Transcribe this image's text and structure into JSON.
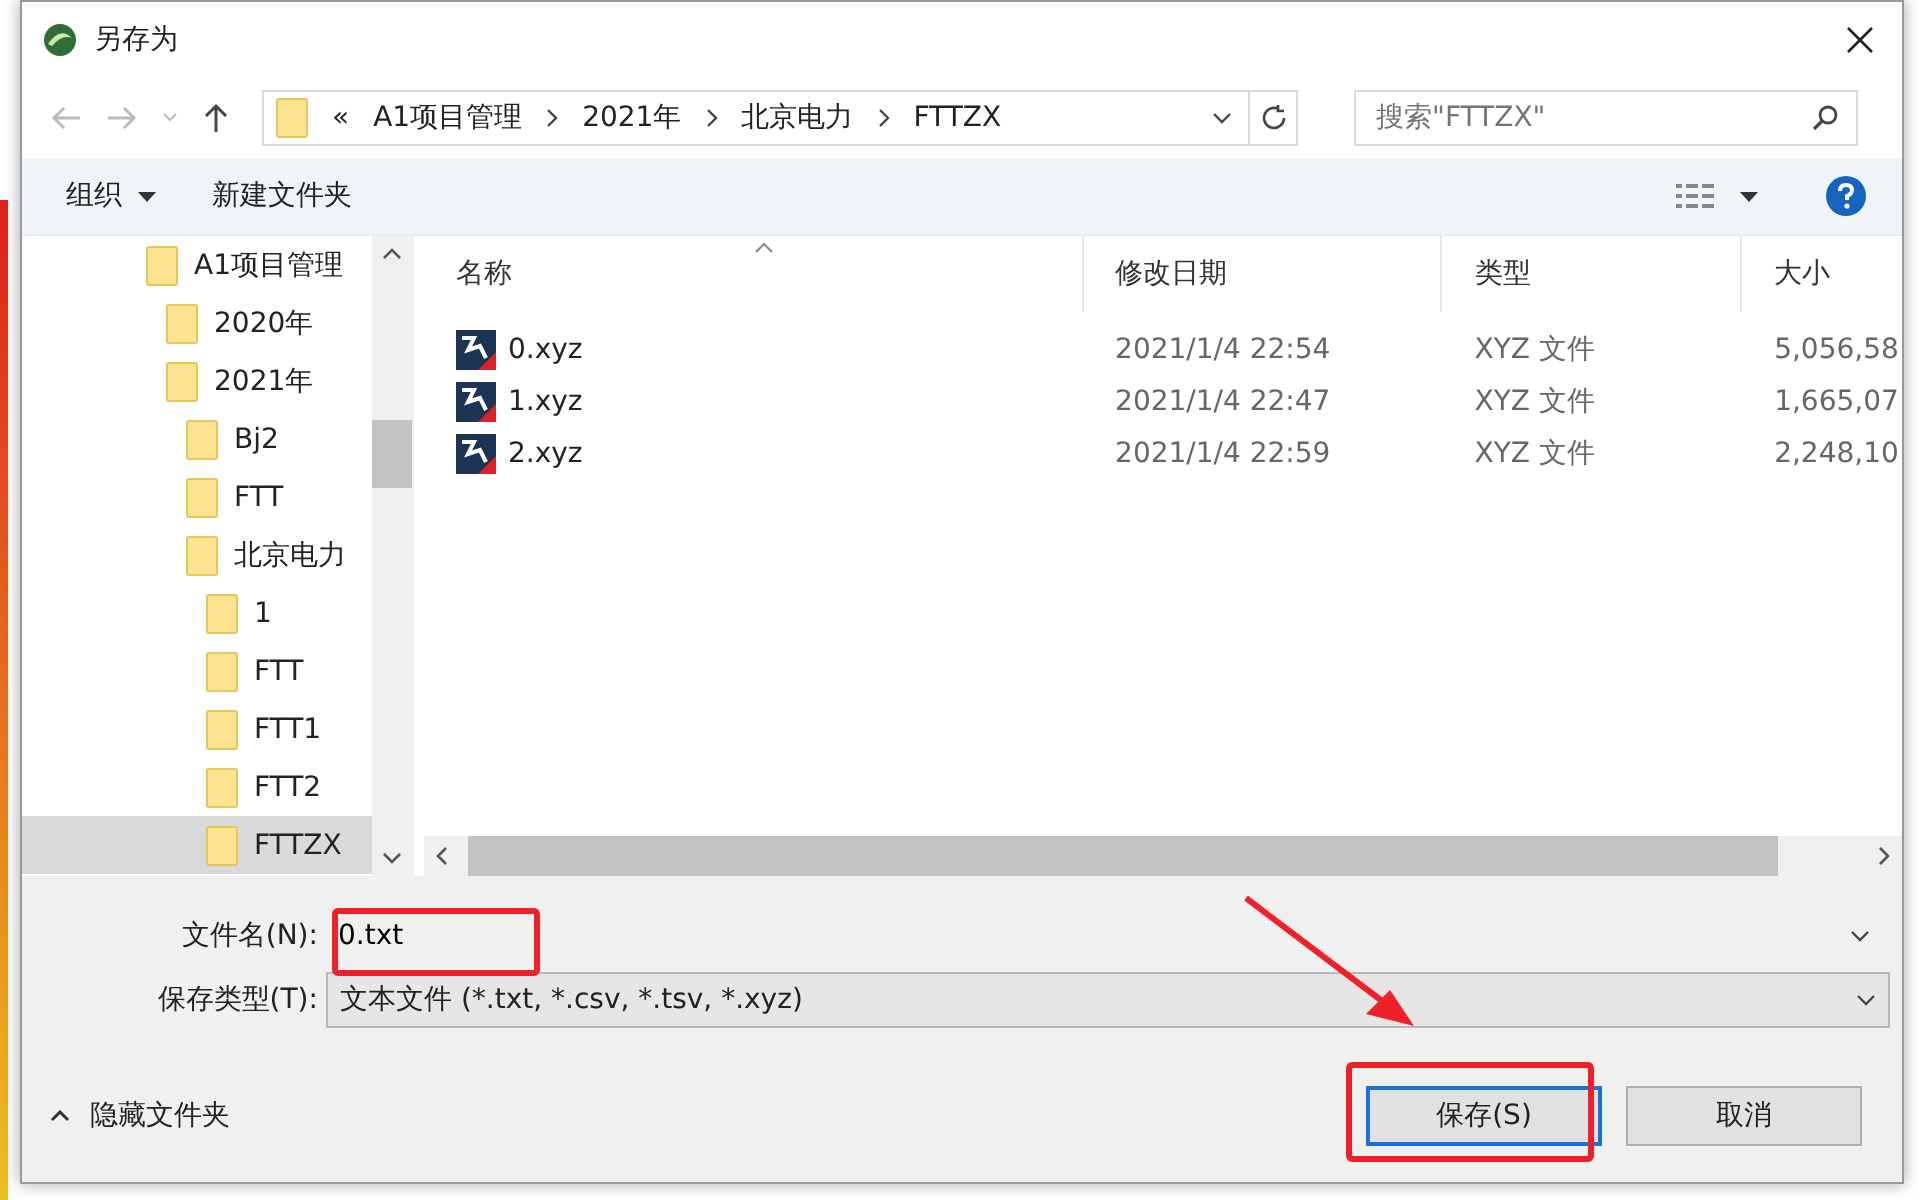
{
  "window": {
    "title": "另存为"
  },
  "address_bar": {
    "overflow": "«",
    "path": [
      "A1项目管理",
      "2021年",
      "北京电力",
      "FTTZX"
    ]
  },
  "search": {
    "placeholder": "搜索\"FTTZX\""
  },
  "toolbar": {
    "organize": "组织",
    "new_folder": "新建文件夹"
  },
  "tree": [
    {
      "label": "A1项目管理",
      "selected": false,
      "children": [
        {
          "label": "2020年",
          "selected": false
        },
        {
          "label": "2021年",
          "selected": false,
          "children": [
            {
              "label": "Bj2",
              "selected": false
            },
            {
              "label": "FTT",
              "selected": false
            },
            {
              "label": "北京电力",
              "selected": false,
              "children": [
                {
                  "label": "1",
                  "selected": false
                },
                {
                  "label": "FTT",
                  "selected": false
                },
                {
                  "label": "FTT1",
                  "selected": false
                },
                {
                  "label": "FTT2",
                  "selected": false
                },
                {
                  "label": "FTTZX",
                  "selected": true
                }
              ]
            }
          ]
        }
      ]
    }
  ],
  "columns": [
    "名称",
    "修改日期",
    "类型",
    "大小"
  ],
  "files": [
    {
      "name": "0.xyz",
      "modified": "2021/1/4 22:54",
      "type": "XYZ 文件",
      "size": "5,056,58"
    },
    {
      "name": "1.xyz",
      "modified": "2021/1/4 22:47",
      "type": "XYZ 文件",
      "size": "1,665,07"
    },
    {
      "name": "2.xyz",
      "modified": "2021/1/4 22:59",
      "type": "XYZ 文件",
      "size": "2,248,10"
    }
  ],
  "filename": {
    "label": "文件名(N):",
    "value": "0.txt"
  },
  "filetype": {
    "label": "保存类型(T):",
    "value": "文本文件 (*.txt, *.csv, *.tsv, *.xyz)"
  },
  "hide_folders": "隐藏文件夹",
  "buttons": {
    "save": "保存(S)",
    "cancel": "取消"
  }
}
